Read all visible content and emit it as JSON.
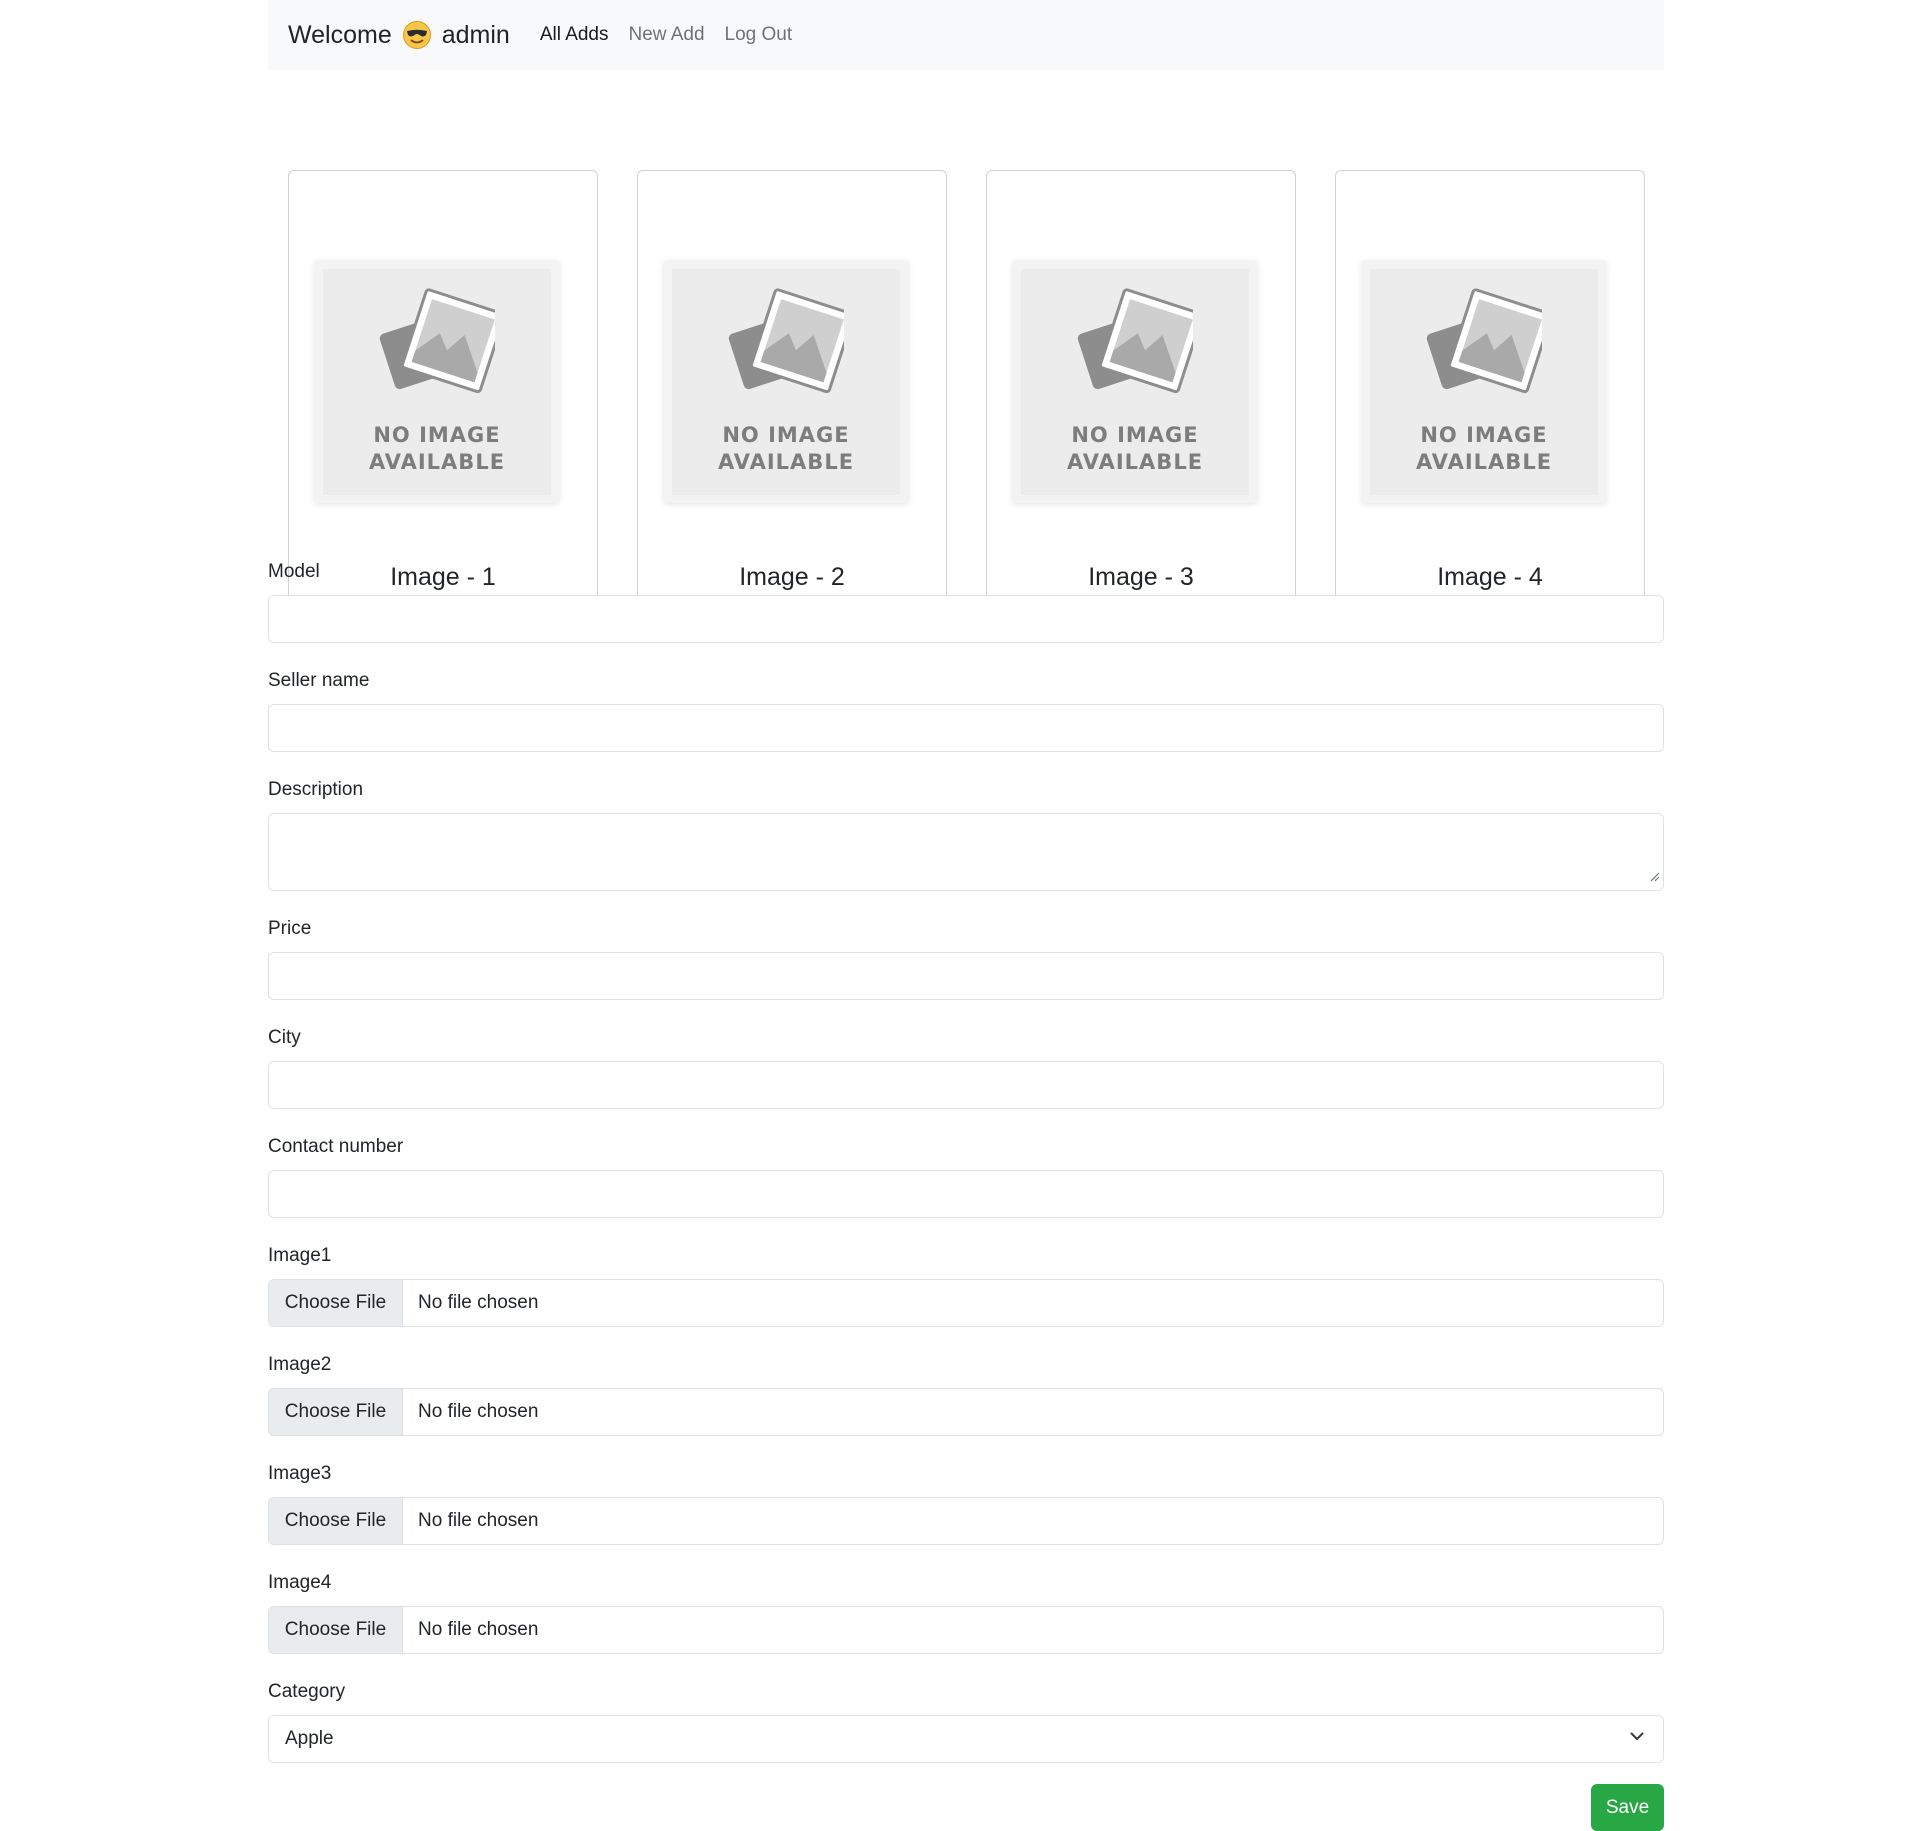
{
  "navbar": {
    "welcome": "Welcome",
    "username": "admin",
    "links": [
      "All Adds",
      "New Add",
      "Log Out"
    ]
  },
  "cards": [
    {
      "placeholder_line1": "NO IMAGE",
      "placeholder_line2": "AVAILABLE",
      "title": "Image - 1"
    },
    {
      "placeholder_line1": "NO IMAGE",
      "placeholder_line2": "AVAILABLE",
      "title": "Image - 2"
    },
    {
      "placeholder_line1": "NO IMAGE",
      "placeholder_line2": "AVAILABLE",
      "title": "Image - 3"
    },
    {
      "placeholder_line1": "NO IMAGE",
      "placeholder_line2": "AVAILABLE",
      "title": "Image - 4"
    }
  ],
  "form": {
    "model_label": "Model",
    "model_value": "",
    "seller_label": "Seller name",
    "seller_value": "",
    "description_label": "Description",
    "description_value": "",
    "price_label": "Price",
    "price_value": "",
    "city_label": "City",
    "city_value": "",
    "contact_label": "Contact number",
    "contact_value": "",
    "images": [
      {
        "label": "Image1",
        "button": "Choose File",
        "status": "No file chosen"
      },
      {
        "label": "Image2",
        "button": "Choose File",
        "status": "No file chosen"
      },
      {
        "label": "Image3",
        "button": "Choose File",
        "status": "No file chosen"
      },
      {
        "label": "Image4",
        "button": "Choose File",
        "status": "No file chosen"
      }
    ],
    "category_label": "Category",
    "category_value": "Apple",
    "save_label": "Save"
  },
  "colors": {
    "navbar_bg": "#f8f9fa",
    "save_button": "#28a745",
    "border": "#dee2e6"
  },
  "icons": [
    "smiling-face-with-sunglasses-emoji",
    "no-image-photo-icon",
    "chevron-down-icon",
    "resize-grip-icon"
  ]
}
